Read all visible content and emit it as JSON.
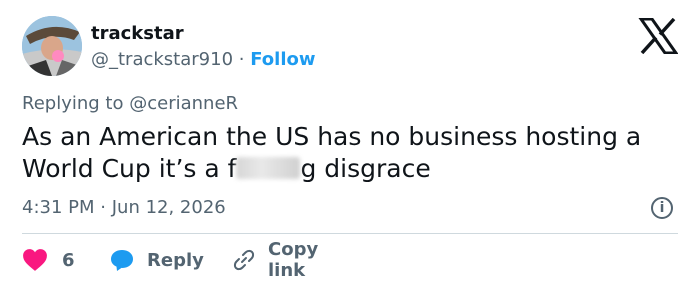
{
  "author": {
    "name": "trackstar",
    "handle": "@_trackstar910",
    "separator": "·",
    "follow_label": "Follow"
  },
  "reply_to": {
    "prefix": "Replying to",
    "mention": "@cerianneR"
  },
  "tweet": {
    "line1": "As an American the US has no business hosting a",
    "line2_before": "World Cup it’s a f",
    "line2_after": "g disgrace"
  },
  "meta": {
    "time": "4:31 PM",
    "separator": "·",
    "date": "Jun 12, 2026"
  },
  "actions": {
    "like_count": "6",
    "reply_label": "Reply",
    "copy_label": "Copy link"
  },
  "colors": {
    "like": "#f91880",
    "reply": "#1d9bf0",
    "follow": "#1d9bf0",
    "secondary_text": "#536471"
  },
  "icons": [
    "x-logo-icon",
    "info-icon",
    "heart-icon",
    "reply-bubble-icon",
    "link-icon"
  ]
}
